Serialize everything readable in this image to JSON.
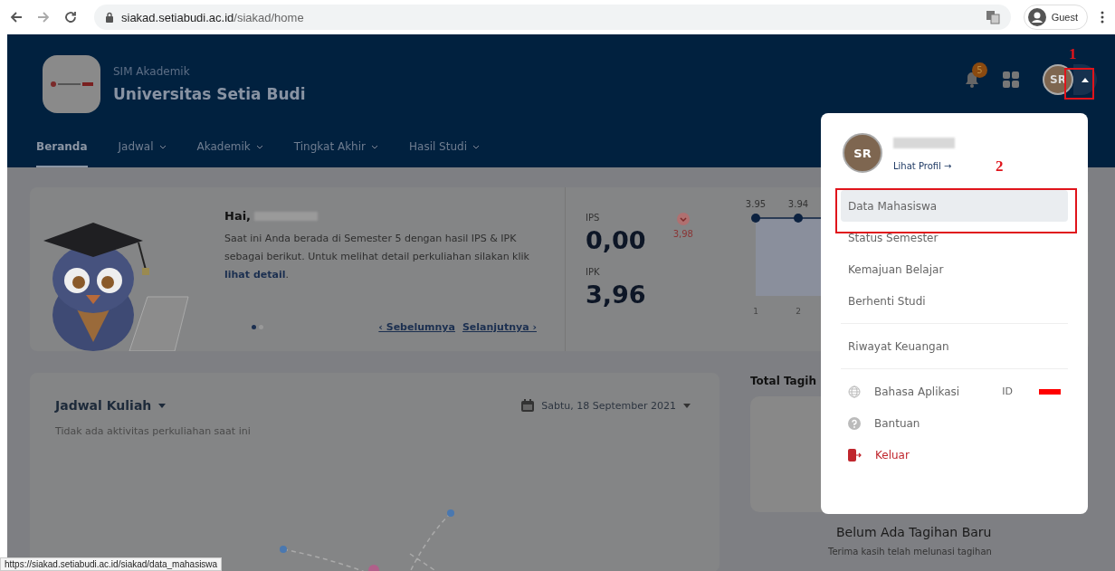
{
  "browser": {
    "url_host": "siakad.setiabudi.ac.id",
    "url_path": "/siakad/home",
    "profile": "Guest",
    "status_url": "https://siakad.setiabudi.ac.id/siakad/data_mahasiswa"
  },
  "header": {
    "subtitle": "SIM Akademik",
    "title": "Universitas Setia Budi",
    "notification_count": "5",
    "avatar": "SR"
  },
  "nav": [
    {
      "label": "Beranda",
      "selected": true,
      "dropdown": false
    },
    {
      "label": "Jadwal",
      "selected": false,
      "dropdown": true
    },
    {
      "label": "Akademik",
      "selected": false,
      "dropdown": true
    },
    {
      "label": "Tingkat Akhir",
      "selected": false,
      "dropdown": true
    },
    {
      "label": "Hasil Studi",
      "selected": false,
      "dropdown": true
    }
  ],
  "hero": {
    "greeting": "Hai,",
    "text": "Saat ini Anda berada di Semester 5 dengan hasil IPS & IPK sebagai berikut. Untuk melihat detail perkuliahan silakan klik ",
    "link": "lihat detail",
    "after": ".",
    "prev": "‹ Sebelumnya",
    "next": "Selanjutnya ›",
    "slides": [
      {
        "selected": true
      },
      {
        "selected": false
      }
    ]
  },
  "stats": {
    "ips_label": "IPS",
    "ips": "0,00",
    "previous": "3,98",
    "ipk_label": "IPK",
    "ipk": "3,96"
  },
  "ips_chart": {
    "point_labels": [
      "3.95",
      "3.94"
    ],
    "x_labels": [
      "1",
      "2"
    ]
  },
  "schedule": {
    "title": "Jadwal Kuliah",
    "date": "Sabtu, 18 September 2021",
    "empty": "Tidak ada aktivitas perkuliahan saat ini"
  },
  "billing": {
    "title": "Total Tagih",
    "empty_title": "Belum Ada Tagihan Baru",
    "empty_text": "Terima kasih telah melunasi tagihan"
  },
  "profile_menu": {
    "avatar": "SR",
    "profile_link": "Lihat Profil →",
    "groups": [
      [
        {
          "label": "Data Mahasiswa",
          "selected": true
        },
        {
          "label": "Status Semester",
          "selected": false
        },
        {
          "label": "Kemajuan Belajar",
          "selected": false
        },
        {
          "label": "Berhenti Studi",
          "selected": false
        }
      ],
      [
        {
          "label": "Riwayat Keuangan",
          "selected": false
        }
      ]
    ],
    "settings": [
      {
        "kind": "language",
        "label": "Bahasa Aplikasi",
        "value": "ID"
      },
      {
        "kind": "help",
        "label": "Bantuan"
      },
      {
        "kind": "logout",
        "label": "Keluar"
      }
    ]
  },
  "annotations": [
    {
      "label": "1"
    },
    {
      "label": "2"
    }
  ]
}
